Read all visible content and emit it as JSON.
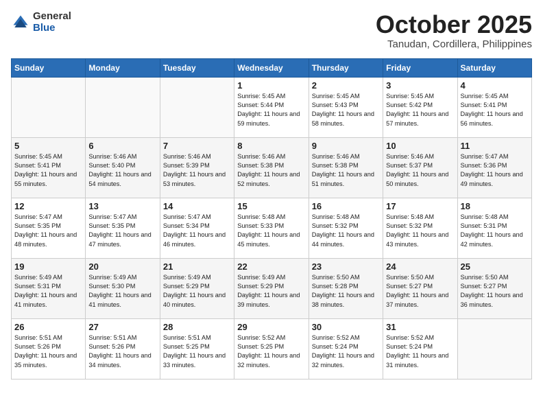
{
  "logo": {
    "general": "General",
    "blue": "Blue"
  },
  "title": {
    "month": "October 2025",
    "location": "Tanudan, Cordillera, Philippines"
  },
  "weekdays": [
    "Sunday",
    "Monday",
    "Tuesday",
    "Wednesday",
    "Thursday",
    "Friday",
    "Saturday"
  ],
  "weeks": [
    [
      {
        "day": "",
        "info": ""
      },
      {
        "day": "",
        "info": ""
      },
      {
        "day": "",
        "info": ""
      },
      {
        "day": "1",
        "info": "Sunrise: 5:45 AM\nSunset: 5:44 PM\nDaylight: 11 hours\nand 59 minutes."
      },
      {
        "day": "2",
        "info": "Sunrise: 5:45 AM\nSunset: 5:43 PM\nDaylight: 11 hours\nand 58 minutes."
      },
      {
        "day": "3",
        "info": "Sunrise: 5:45 AM\nSunset: 5:42 PM\nDaylight: 11 hours\nand 57 minutes."
      },
      {
        "day": "4",
        "info": "Sunrise: 5:45 AM\nSunset: 5:41 PM\nDaylight: 11 hours\nand 56 minutes."
      }
    ],
    [
      {
        "day": "5",
        "info": "Sunrise: 5:45 AM\nSunset: 5:41 PM\nDaylight: 11 hours\nand 55 minutes."
      },
      {
        "day": "6",
        "info": "Sunrise: 5:46 AM\nSunset: 5:40 PM\nDaylight: 11 hours\nand 54 minutes."
      },
      {
        "day": "7",
        "info": "Sunrise: 5:46 AM\nSunset: 5:39 PM\nDaylight: 11 hours\nand 53 minutes."
      },
      {
        "day": "8",
        "info": "Sunrise: 5:46 AM\nSunset: 5:38 PM\nDaylight: 11 hours\nand 52 minutes."
      },
      {
        "day": "9",
        "info": "Sunrise: 5:46 AM\nSunset: 5:38 PM\nDaylight: 11 hours\nand 51 minutes."
      },
      {
        "day": "10",
        "info": "Sunrise: 5:46 AM\nSunset: 5:37 PM\nDaylight: 11 hours\nand 50 minutes."
      },
      {
        "day": "11",
        "info": "Sunrise: 5:47 AM\nSunset: 5:36 PM\nDaylight: 11 hours\nand 49 minutes."
      }
    ],
    [
      {
        "day": "12",
        "info": "Sunrise: 5:47 AM\nSunset: 5:35 PM\nDaylight: 11 hours\nand 48 minutes."
      },
      {
        "day": "13",
        "info": "Sunrise: 5:47 AM\nSunset: 5:35 PM\nDaylight: 11 hours\nand 47 minutes."
      },
      {
        "day": "14",
        "info": "Sunrise: 5:47 AM\nSunset: 5:34 PM\nDaylight: 11 hours\nand 46 minutes."
      },
      {
        "day": "15",
        "info": "Sunrise: 5:48 AM\nSunset: 5:33 PM\nDaylight: 11 hours\nand 45 minutes."
      },
      {
        "day": "16",
        "info": "Sunrise: 5:48 AM\nSunset: 5:32 PM\nDaylight: 11 hours\nand 44 minutes."
      },
      {
        "day": "17",
        "info": "Sunrise: 5:48 AM\nSunset: 5:32 PM\nDaylight: 11 hours\nand 43 minutes."
      },
      {
        "day": "18",
        "info": "Sunrise: 5:48 AM\nSunset: 5:31 PM\nDaylight: 11 hours\nand 42 minutes."
      }
    ],
    [
      {
        "day": "19",
        "info": "Sunrise: 5:49 AM\nSunset: 5:31 PM\nDaylight: 11 hours\nand 41 minutes."
      },
      {
        "day": "20",
        "info": "Sunrise: 5:49 AM\nSunset: 5:30 PM\nDaylight: 11 hours\nand 41 minutes."
      },
      {
        "day": "21",
        "info": "Sunrise: 5:49 AM\nSunset: 5:29 PM\nDaylight: 11 hours\nand 40 minutes."
      },
      {
        "day": "22",
        "info": "Sunrise: 5:49 AM\nSunset: 5:29 PM\nDaylight: 11 hours\nand 39 minutes."
      },
      {
        "day": "23",
        "info": "Sunrise: 5:50 AM\nSunset: 5:28 PM\nDaylight: 11 hours\nand 38 minutes."
      },
      {
        "day": "24",
        "info": "Sunrise: 5:50 AM\nSunset: 5:27 PM\nDaylight: 11 hours\nand 37 minutes."
      },
      {
        "day": "25",
        "info": "Sunrise: 5:50 AM\nSunset: 5:27 PM\nDaylight: 11 hours\nand 36 minutes."
      }
    ],
    [
      {
        "day": "26",
        "info": "Sunrise: 5:51 AM\nSunset: 5:26 PM\nDaylight: 11 hours\nand 35 minutes."
      },
      {
        "day": "27",
        "info": "Sunrise: 5:51 AM\nSunset: 5:26 PM\nDaylight: 11 hours\nand 34 minutes."
      },
      {
        "day": "28",
        "info": "Sunrise: 5:51 AM\nSunset: 5:25 PM\nDaylight: 11 hours\nand 33 minutes."
      },
      {
        "day": "29",
        "info": "Sunrise: 5:52 AM\nSunset: 5:25 PM\nDaylight: 11 hours\nand 32 minutes."
      },
      {
        "day": "30",
        "info": "Sunrise: 5:52 AM\nSunset: 5:24 PM\nDaylight: 11 hours\nand 32 minutes."
      },
      {
        "day": "31",
        "info": "Sunrise: 5:52 AM\nSunset: 5:24 PM\nDaylight: 11 hours\nand 31 minutes."
      },
      {
        "day": "",
        "info": ""
      }
    ]
  ]
}
